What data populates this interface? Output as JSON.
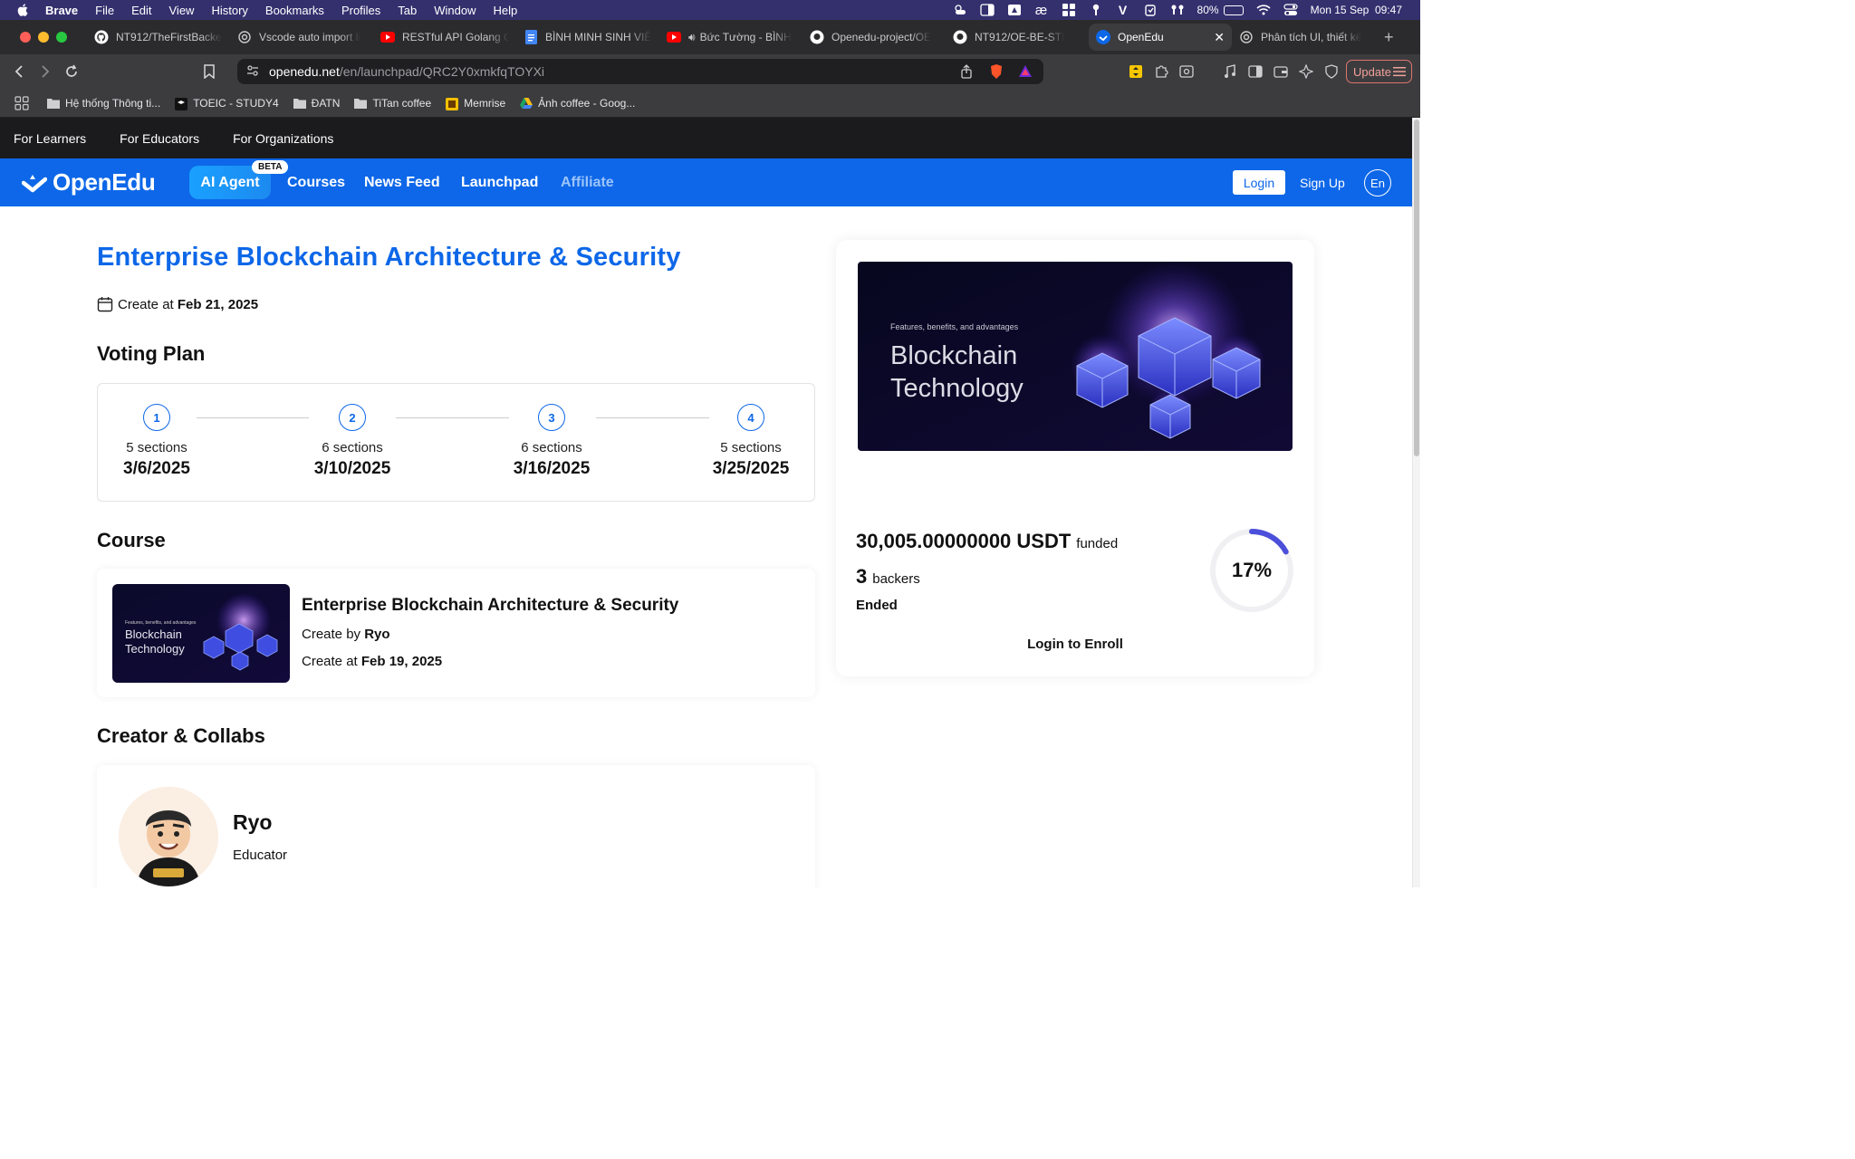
{
  "menubar": {
    "app": "Brave",
    "items": [
      "File",
      "Edit",
      "View",
      "History",
      "Bookmarks",
      "Profiles",
      "Tab",
      "Window",
      "Help"
    ],
    "battery": "80%",
    "battery_level": 0.8,
    "clock": "Mon 15 Sep  09:47"
  },
  "tabs": [
    {
      "label": "NT912/TheFirstBacke",
      "icon": "github-icon"
    },
    {
      "label": "Vscode auto import li",
      "icon": "openai-icon"
    },
    {
      "label": "RESTful API Golang C",
      "icon": "youtube-icon"
    },
    {
      "label": "BÌNH MINH SINH VIÊ",
      "icon": "docs-icon"
    },
    {
      "label": "Bức Tường - BÌNH",
      "icon": "youtube-icon"
    },
    {
      "label": "Openedu-project/OE",
      "icon": "github-icon"
    },
    {
      "label": "NT912/OE-BE-STI",
      "icon": "github-icon"
    },
    {
      "label": "OpenEdu",
      "icon": "openedu-icon",
      "active": true
    },
    {
      "label": "Phân tích UI, thiết kế",
      "icon": "openai-icon"
    }
  ],
  "address": {
    "host": "openedu.net",
    "path": "/en/launchpad/QRC2Y0xmkfqTOYXi"
  },
  "toolbar": {
    "update_label": "Update"
  },
  "bookmarks": [
    {
      "label": "Hệ thống Thông ti...",
      "icon": "folder-icon"
    },
    {
      "label": "TOEIC - STUDY4",
      "icon": "study4-icon"
    },
    {
      "label": "ĐATN",
      "icon": "folder-icon"
    },
    {
      "label": "TiTan coffee",
      "icon": "folder-icon"
    },
    {
      "label": "Memrise",
      "icon": "memrise-icon"
    },
    {
      "label": "Ảnh coffee - Goog...",
      "icon": "drive-icon"
    }
  ],
  "topnav": [
    "For Learners",
    "For Educators",
    "For Organizations"
  ],
  "mainnav": {
    "logo": "OpenEdu",
    "ai_agent": "AI Agent",
    "beta": "BETA",
    "links": [
      "Courses",
      "News Feed",
      "Launchpad"
    ],
    "affiliate": "Affiliate",
    "login": "Login",
    "signup": "Sign Up",
    "lang": "En"
  },
  "launchpad": {
    "title": "Enterprise Blockchain Architecture & Security",
    "created_label": "Create at",
    "created_date": "Feb 21, 2025",
    "voting_plan_heading": "Voting Plan",
    "steps": [
      {
        "num": "1",
        "sections": "5 sections",
        "date": "3/6/2025"
      },
      {
        "num": "2",
        "sections": "6 sections",
        "date": "3/10/2025"
      },
      {
        "num": "3",
        "sections": "6 sections",
        "date": "3/16/2025"
      },
      {
        "num": "4",
        "sections": "5 sections",
        "date": "3/25/2025"
      }
    ],
    "course_heading": "Course",
    "course": {
      "name": "Enterprise Blockchain Architecture & Security",
      "created_by_label": "Create by",
      "creator": "Ryo",
      "created_label": "Create at",
      "created_date": "Feb 19, 2025",
      "thumb_line1": "Blockchain",
      "thumb_line2": "Technology",
      "thumb_caption": "Features, benefits, and advantages"
    },
    "creators_heading": "Creator & Collabs",
    "creator": {
      "name": "Ryo",
      "role": "Educator"
    },
    "funding": {
      "amount": "30,005.00000000 USDT",
      "funded_label": "funded",
      "backers": "3",
      "backers_label": "backers",
      "status": "Ended",
      "percent_text": "17%",
      "percent": 17,
      "enroll_label": "Login to Enroll"
    },
    "hero": {
      "caption": "Features, benefits, and advantages",
      "line1": "Blockchain",
      "line2": "Technology"
    }
  },
  "colors": {
    "brand": "#0d67e8",
    "menubar": "#34306e",
    "progress": "#4b4fd9"
  }
}
